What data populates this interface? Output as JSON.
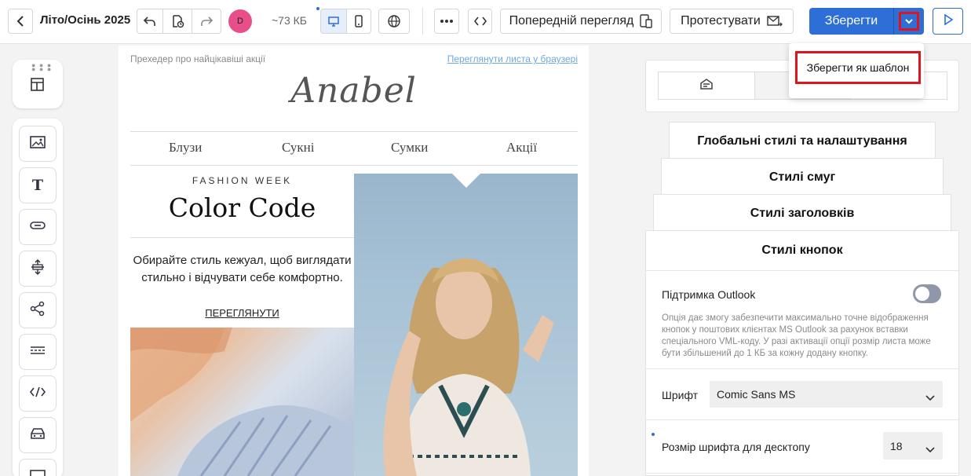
{
  "toolbar": {
    "back_icon": "chevron-left-icon",
    "title": "Літо/Осінь 2025",
    "undo_icon": "undo-icon",
    "history_icon": "document-history-icon",
    "redo_icon": "redo-icon",
    "avatar_letter": "D",
    "avatar_color": "#e84f8a",
    "size": "~73 КБ",
    "desktop_icon": "desktop-icon",
    "mobile_icon": "mobile-icon",
    "language_icon": "globe-icon",
    "more_icon": "more-dots-icon",
    "code_icon": "code-icon",
    "preview_label": "Попередній перегляд",
    "test_label": "Протестувати",
    "save_label": "Зберегти",
    "save_dropdown_icon": "chevron-down-icon",
    "run_icon": "play-icon",
    "accent_color": "#2d6fd6"
  },
  "dropdown": {
    "save_as_template": "Зберегти як шаблон"
  },
  "left_tools": [
    "layout-blocks-icon",
    "image-icon",
    "text-icon",
    "button-icon",
    "spacer-icon",
    "social-share-icon",
    "menu-icon",
    "html-code-icon",
    "product-icon",
    "video-icon"
  ],
  "email": {
    "preheader": "Прехедер про найцікавіші акції",
    "view_in_browser": "Переглянути листа у браузері",
    "logo": "Anabel",
    "nav": [
      "Блузи",
      "Сукні",
      "Сумки",
      "Акції"
    ],
    "eyebrow": "FASHION WEEK",
    "headline": "Color Code",
    "description": "Обирайте стиль кежуал, щоб виглядати стильно і відчувати себе комфортно.",
    "cta": "ПЕРЕГЛЯНУТИ"
  },
  "panel": {
    "tabs": [
      "mailbox-icon",
      "",
      ""
    ],
    "sections": [
      "Глобальні стилі та налаштування",
      "Стилі смуг",
      "Стилі заголовків",
      "Стилі кнопок"
    ],
    "outlook_label": "Підтримка Outlook",
    "outlook_enabled": false,
    "outlook_desc": "Опція дає змогу забезпечити максимально точне відображення кнопок у поштових клієнтах MS Outlook за рахунок вставки спеціального VML-коду. У разі активації опції розмір листа може бути збільшений до 1 КБ за кожну додану кнопку.",
    "font_label": "Шрифт",
    "font_value": "Comic Sans MS",
    "font_size_label": "Розмір шрифта для десктопу",
    "font_size_value": "18"
  }
}
